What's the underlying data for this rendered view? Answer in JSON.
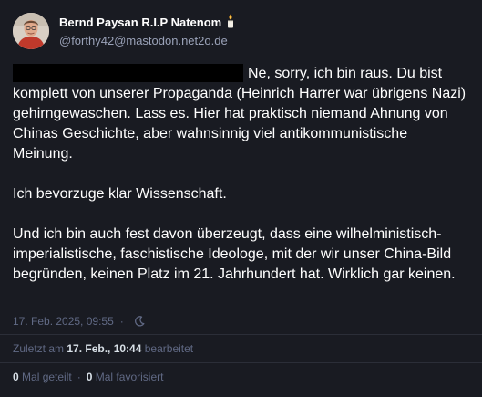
{
  "author": {
    "display_name": "Bernd Paysan R.I.P Natenom",
    "handle": "@forthy42@mastodon.net2o.de",
    "name_emoji_icon": "candle-icon"
  },
  "status": {
    "paragraphs": [
      "Ne, sorry, ich bin raus. Du bist komplett von unserer Propaganda (Heinrich Harrer war übrigens Nazi) gehirngewaschen. Lass es. Hier hat praktisch niemand Ahnung von Chinas Geschichte, aber wahnsinnig viel antikommunistische Meinung.",
      "Ich bevorzuge klar Wissenschaft.",
      "Und ich bin auch fest davon überzeugt, dass eine wilhelministisch-imperialistische, faschistische Ideologe, mit der wir unser China-Bild begründen, keinen Platz im 21. Jahrhundert hat. Wirklich gar keinen."
    ]
  },
  "meta": {
    "timestamp": "17. Feb. 2025, 09:55",
    "separator": "·",
    "visibility_icon": "moon-icon"
  },
  "edited": {
    "prefix": "Zuletzt am",
    "date": "17. Feb., 10:44",
    "suffix": "bearbeitet"
  },
  "stats": {
    "boosts_count": "0",
    "boosts_label": "Mal geteilt",
    "favourites_count": "0",
    "favourites_label": "Mal favorisiert",
    "separator": "·"
  },
  "colors": {
    "background": "#191b22",
    "text": "#ffffff",
    "secondary_text": "#9aa2b8",
    "muted_text": "#606984",
    "divider": "#2b2e38"
  }
}
